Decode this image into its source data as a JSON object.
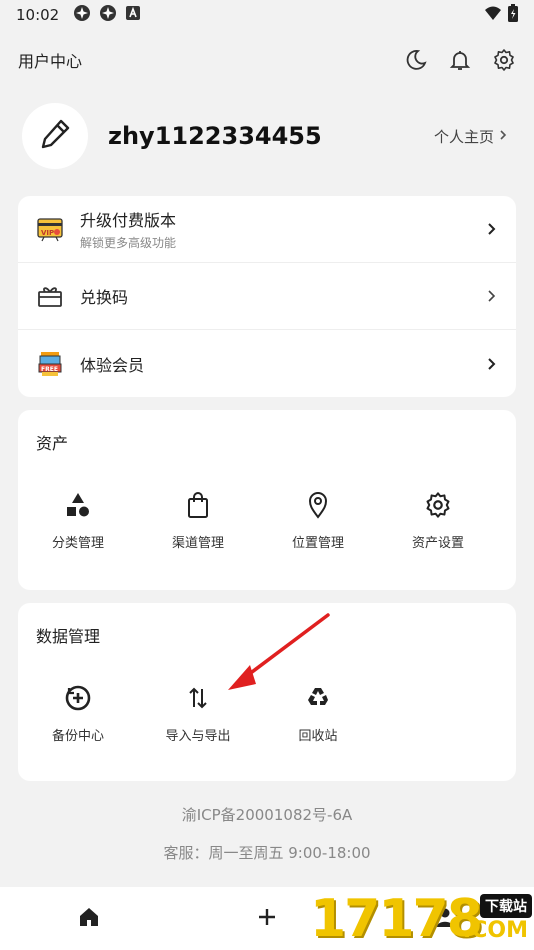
{
  "status": {
    "time": "10:02"
  },
  "topbar": {
    "title": "用户中心"
  },
  "profile": {
    "username": "zhy1122334455",
    "homepage_label": "个人主页"
  },
  "menu": [
    {
      "title": "升级付费版本",
      "subtitle": "解锁更多高级功能",
      "icon": "vip-card-icon"
    },
    {
      "title": "兑换码",
      "subtitle": "",
      "icon": "gift-icon"
    },
    {
      "title": "体验会员",
      "subtitle": "",
      "icon": "free-gift-icon"
    }
  ],
  "assets": {
    "title": "资产",
    "items": [
      "分类管理",
      "渠道管理",
      "位置管理",
      "资产设置"
    ]
  },
  "data_mgmt": {
    "title": "数据管理",
    "items": [
      "备份中心",
      "导入与导出",
      "回收站"
    ]
  },
  "footer": {
    "icp": "渝ICP备20001082号-6A",
    "service": "客服：周一至周五 9:00-18:00"
  },
  "watermark": {
    "digits": "17178",
    "badge": "下载站",
    "suffix": ".COM"
  },
  "colors": {
    "accent": "#222222",
    "arrow": "#e02020",
    "watermark": "#f0c400"
  }
}
